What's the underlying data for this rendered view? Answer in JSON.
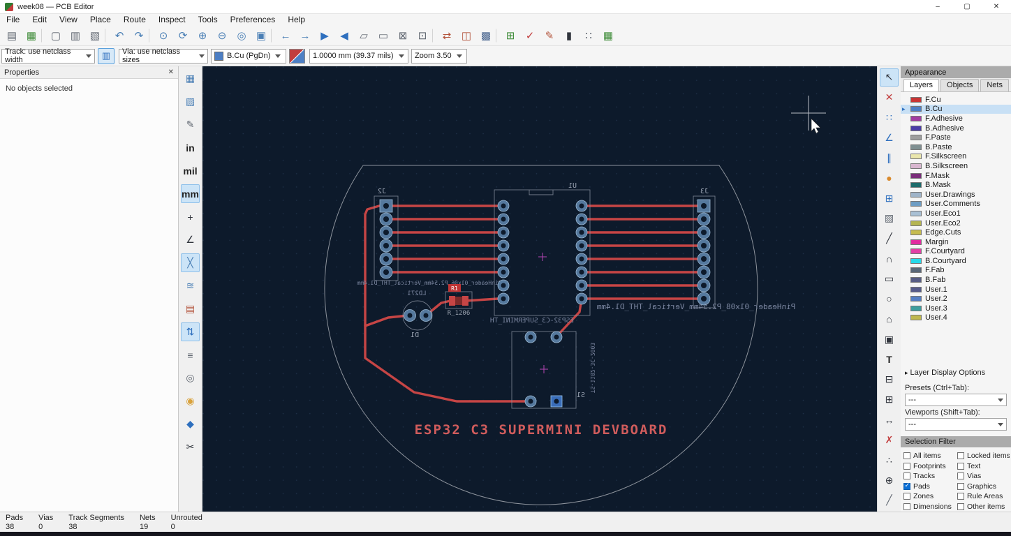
{
  "window": {
    "title": "week08 — PCB Editor",
    "controls": {
      "minimize": "–",
      "maximize": "▢",
      "close": "✕"
    }
  },
  "menubar": {
    "items": [
      "File",
      "Edit",
      "View",
      "Place",
      "Route",
      "Inspect",
      "Tools",
      "Preferences",
      "Help"
    ]
  },
  "toolbar_main": {
    "icons": [
      {
        "name": "save-icon",
        "glyph": "▤",
        "color": "#5f6670"
      },
      {
        "name": "board-setup-icon",
        "glyph": "▦",
        "color": "#3d8b37"
      },
      {
        "sep": true
      },
      {
        "name": "page-settings-icon",
        "glyph": "▢",
        "color": "#5f6670"
      },
      {
        "name": "print-icon",
        "glyph": "▥",
        "color": "#5f6670"
      },
      {
        "name": "plot-icon",
        "glyph": "▧",
        "color": "#5f6670"
      },
      {
        "sep": true
      },
      {
        "name": "undo-icon",
        "glyph": "↶",
        "color": "#4a7fb5"
      },
      {
        "name": "redo-icon",
        "glyph": "↷",
        "color": "#4a7fb5"
      },
      {
        "sep": true
      },
      {
        "name": "find-icon",
        "glyph": "⊙",
        "color": "#4a7fb5"
      },
      {
        "name": "refresh-icon",
        "glyph": "⟳",
        "color": "#4a7fb5"
      },
      {
        "name": "zoom-in-icon",
        "glyph": "⊕",
        "color": "#4a7fb5"
      },
      {
        "name": "zoom-out-icon",
        "glyph": "⊖",
        "color": "#4a7fb5"
      },
      {
        "name": "zoom-fit-icon",
        "glyph": "◎",
        "color": "#4a7fb5"
      },
      {
        "name": "zoom-selection-icon",
        "glyph": "▣",
        "color": "#4a7fb5"
      },
      {
        "sep": true
      },
      {
        "name": "prev-marker-icon",
        "glyph": "←",
        "color": "#4a7fb5"
      },
      {
        "name": "next-marker-icon",
        "glyph": "→",
        "color": "#4a7fb5"
      },
      {
        "name": "flip-view-icon",
        "glyph": "▶",
        "color": "#2e6fbe"
      },
      {
        "name": "mirror-view-icon",
        "glyph": "◀",
        "color": "#2e6fbe"
      },
      {
        "name": "group-icon",
        "glyph": "▱",
        "color": "#5f6670"
      },
      {
        "name": "ungroup-icon",
        "glyph": "▭",
        "color": "#5f6670"
      },
      {
        "name": "lock-icon",
        "glyph": "⊠",
        "color": "#5f6670"
      },
      {
        "name": "unlock-icon",
        "glyph": "⊡",
        "color": "#5f6670"
      },
      {
        "sep": true
      },
      {
        "name": "update-pcb-from-schematic-icon",
        "glyph": "⇄",
        "color": "#b3543c"
      },
      {
        "name": "footprint-compare-icon",
        "glyph": "◫",
        "color": "#b3543c"
      },
      {
        "name": "layers-viewer-icon",
        "glyph": "▩",
        "color": "#44618c"
      },
      {
        "sep": true
      },
      {
        "name": "update-footprints-icon",
        "glyph": "⊞",
        "color": "#3d8b37"
      },
      {
        "name": "drc-icon",
        "glyph": "✓",
        "color": "#c23d3d"
      },
      {
        "name": "footprint-editor-icon",
        "glyph": "✎",
        "color": "#b3543c"
      },
      {
        "name": "scripting-console-icon",
        "glyph": "▮",
        "color": "#30343c"
      },
      {
        "name": "measure-icon",
        "glyph": "∷",
        "color": "#5f6670"
      },
      {
        "name": "grid-settings-icon",
        "glyph": "▦",
        "color": "#3d8b37"
      }
    ]
  },
  "toolbar_opts": {
    "track": "Track: use netclass width",
    "via": "Via: use netclass sizes",
    "layer": "B.Cu (PgDn)",
    "layer_color": "#4D7FC4",
    "grid": "1.0000 mm (39.37 mils)",
    "zoom": "Zoom 3.50"
  },
  "properties_panel": {
    "title": "Properties",
    "close_glyph": "✕",
    "message": "No objects selected"
  },
  "left_toolbar": {
    "icons": [
      {
        "name": "grid-visibility-icon",
        "glyph": "▦",
        "color": "#4a7fb5"
      },
      {
        "name": "grid-overrides-icon",
        "glyph": "▨",
        "color": "#4a7fb5"
      },
      {
        "name": "edit-grid-icon",
        "glyph": "✎",
        "color": "#5f6670"
      },
      {
        "name": "units-inches-button",
        "glyph": "in",
        "text": true
      },
      {
        "name": "units-mils-button",
        "glyph": "mil",
        "text": true
      },
      {
        "name": "units-mm-button",
        "glyph": "mm",
        "text": true,
        "active": true
      },
      {
        "name": "crosshair-style-icon",
        "glyph": "+",
        "color": "#30343c"
      },
      {
        "name": "polar-coords-icon",
        "glyph": "∠",
        "color": "#30343c"
      },
      {
        "name": "ratsnest-visibility-icon",
        "glyph": "╳",
        "color": "#4a7fb5",
        "active": true
      },
      {
        "name": "curved-ratsnest-icon",
        "glyph": "≋",
        "color": "#4a7fb5"
      },
      {
        "name": "net-color-mode-icon",
        "glyph": "▤",
        "color": "#b3543c"
      },
      {
        "name": "flip-board-view-icon",
        "glyph": "⇅",
        "color": "#2e6fbe",
        "active": true
      },
      {
        "name": "track-outline-mode-icon",
        "glyph": "≡",
        "color": "#5f6670"
      },
      {
        "name": "via-outline-mode-icon",
        "glyph": "◎",
        "color": "#5f6670"
      },
      {
        "name": "pad-outline-mode-icon",
        "glyph": "◉",
        "color": "#d9a23c"
      },
      {
        "name": "zone-fill-mode-icon",
        "glyph": "◆",
        "color": "#2e6fbe"
      },
      {
        "name": "zone-outline-mode-icon",
        "glyph": "✂",
        "color": "#30343c"
      }
    ]
  },
  "right_toolbar": {
    "icons": [
      {
        "name": "select-tool-icon",
        "glyph": "↖",
        "color": "#30343c",
        "active": true
      },
      {
        "name": "local-ratsnest-icon",
        "glyph": "✕",
        "color": "#c23d3d"
      },
      {
        "name": "highlight-net-icon",
        "glyph": "∷",
        "color": "#2e6fbe"
      },
      {
        "name": "route-tracks-icon",
        "glyph": "∠",
        "color": "#2e6fbe"
      },
      {
        "name": "route-diff-pair-icon",
        "glyph": "∥",
        "color": "#2e6fbe"
      },
      {
        "name": "add-via-icon",
        "glyph": "●",
        "color": "#d9892c"
      },
      {
        "name": "add-footprint-icon",
        "glyph": "⊞",
        "color": "#2e6fbe"
      },
      {
        "name": "add-zone-icon",
        "glyph": "▨",
        "color": "#5f6670"
      },
      {
        "name": "draw-line-icon",
        "glyph": "╱",
        "color": "#30343c"
      },
      {
        "name": "draw-arc-icon",
        "glyph": "∩",
        "color": "#30343c"
      },
      {
        "name": "draw-rectangle-icon",
        "glyph": "▭",
        "color": "#30343c"
      },
      {
        "name": "draw-circle-icon",
        "glyph": "○",
        "color": "#30343c"
      },
      {
        "name": "draw-polygon-icon",
        "glyph": "⌂",
        "color": "#30343c"
      },
      {
        "name": "add-image-icon",
        "glyph": "▣",
        "color": "#30343c"
      },
      {
        "name": "add-text-icon",
        "glyph": "T",
        "text": true
      },
      {
        "name": "add-textbox-icon",
        "glyph": "⊟",
        "color": "#30343c"
      },
      {
        "name": "add-table-icon",
        "glyph": "⊞",
        "color": "#30343c"
      },
      {
        "name": "add-dimension-icon",
        "glyph": "↔",
        "color": "#30343c"
      },
      {
        "name": "delete-tool-icon",
        "glyph": "✗",
        "color": "#c23d3d"
      },
      {
        "name": "grid-origin-icon",
        "glyph": "∴",
        "color": "#30343c"
      },
      {
        "name": "drill-origin-icon",
        "glyph": "⊕",
        "color": "#30343c"
      },
      {
        "name": "measure-tool-icon",
        "glyph": "╱",
        "color": "#5f6670"
      }
    ]
  },
  "canvas": {
    "board_title": "ESP32 C3 SUPERMINI DEVBOARD",
    "refs": {
      "j2": "J2",
      "j3": "J3",
      "u1": "U1",
      "r1": "R1",
      "d1": "D1",
      "s1": "S1"
    },
    "values": {
      "j2": "PinHeader_01x06_P2.54mm_Vertical_THT_D1.4mm",
      "j3": "PinHeader_01x08_P2.54mm_Vertical_THT_D1.4mm",
      "u1": "ESP32-C3_SUPERMINI_TH",
      "r1": "R_1206",
      "d1": "LD271",
      "s1": "TS-1102-3C-2003"
    }
  },
  "appearance": {
    "title": "Appearance",
    "tabs": [
      {
        "label": "Layers",
        "active": true
      },
      {
        "label": "Objects"
      },
      {
        "label": "Nets"
      }
    ],
    "layers": [
      {
        "name": "F.Cu",
        "color": "#C83434"
      },
      {
        "name": "B.Cu",
        "color": "#4D7FC4",
        "selected": true
      },
      {
        "name": "F.Adhesive",
        "color": "#A23CA2"
      },
      {
        "name": "B.Adhesive",
        "color": "#4B3DA8"
      },
      {
        "name": "F.Paste",
        "color": "#9E9E9E"
      },
      {
        "name": "B.Paste",
        "color": "#7F8F91"
      },
      {
        "name": "F.Silkscreen",
        "color": "#EAE6AC"
      },
      {
        "name": "B.Silkscreen",
        "color": "#D8B6CF"
      },
      {
        "name": "F.Mask",
        "color": "#7A2D7A"
      },
      {
        "name": "B.Mask",
        "color": "#1E6B6B"
      },
      {
        "name": "User.Drawings",
        "color": "#9FB4C9"
      },
      {
        "name": "User.Comments",
        "color": "#6E9DC4"
      },
      {
        "name": "User.Eco1",
        "color": "#A9C0D4"
      },
      {
        "name": "User.Eco2",
        "color": "#B5B552"
      },
      {
        "name": "Edge.Cuts",
        "color": "#C6BC50"
      },
      {
        "name": "Margin",
        "color": "#E12DA0"
      },
      {
        "name": "F.Courtyard",
        "color": "#E23FA5"
      },
      {
        "name": "B.Courtyard",
        "color": "#26D9E9"
      },
      {
        "name": "F.Fab",
        "color": "#5A6878"
      },
      {
        "name": "B.Fab",
        "color": "#585D84"
      },
      {
        "name": "User.1",
        "color": "#565B8A"
      },
      {
        "name": "User.2",
        "color": "#557FC4"
      },
      {
        "name": "User.3",
        "color": "#3D9E9E"
      },
      {
        "name": "User.4",
        "color": "#BFB84F"
      }
    ],
    "expander_glyph": "▸",
    "layer_display_options": "Layer Display Options",
    "presets_label": "Presets (Ctrl+Tab):",
    "presets_value": "---",
    "viewports_label": "Viewports (Shift+Tab):",
    "viewports_value": "---"
  },
  "selection_filter": {
    "title": "Selection Filter",
    "items": [
      {
        "label": "All items",
        "checked": false
      },
      {
        "label": "Locked items",
        "checked": false
      },
      {
        "label": "Footprints",
        "checked": false
      },
      {
        "label": "Text",
        "checked": false
      },
      {
        "label": "Tracks",
        "checked": false
      },
      {
        "label": "Vias",
        "checked": false
      },
      {
        "label": "Pads",
        "checked": true
      },
      {
        "label": "Graphics",
        "checked": false
      },
      {
        "label": "Zones",
        "checked": false
      },
      {
        "label": "Rule Areas",
        "checked": false
      },
      {
        "label": "Dimensions",
        "checked": false
      },
      {
        "label": "Other items",
        "checked": false
      }
    ]
  },
  "statusbar": {
    "items": [
      {
        "label": "Pads",
        "value": "38"
      },
      {
        "label": "Vias",
        "value": "0"
      },
      {
        "label": "Track Segments",
        "value": "38"
      },
      {
        "label": "Nets",
        "value": "19"
      },
      {
        "label": "Unrouted",
        "value": "0"
      }
    ]
  }
}
